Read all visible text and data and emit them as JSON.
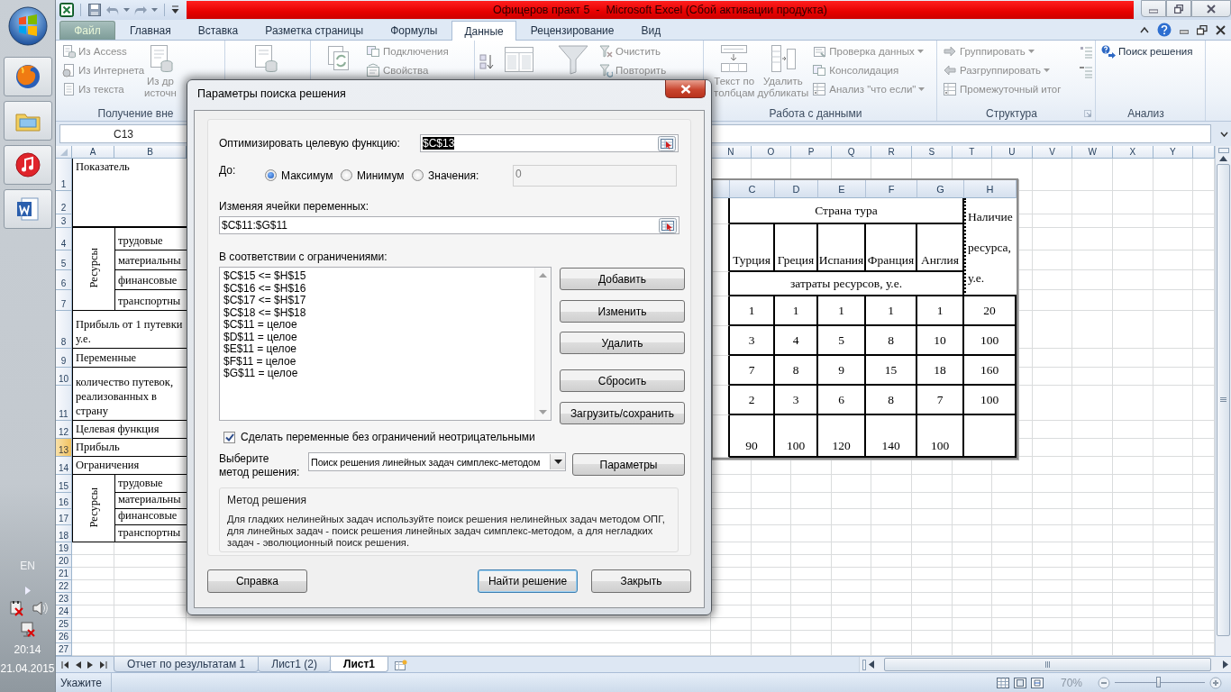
{
  "taskbar": {
    "language": "EN",
    "time": "20:14",
    "date": "21.04.2015"
  },
  "window": {
    "title": "Офицеров практ 5  -  Microsoft Excel (Сбой активации продукта)"
  },
  "ribbon_tabs": [
    {
      "label": "Файл",
      "kind": "file",
      "selected": false
    },
    {
      "label": "Главная",
      "kind": "tab",
      "selected": false
    },
    {
      "label": "Вставка",
      "kind": "tab",
      "selected": false
    },
    {
      "label": "Разметка страницы",
      "kind": "tab",
      "selected": false
    },
    {
      "label": "Формулы",
      "kind": "tab",
      "selected": false
    },
    {
      "label": "Данные",
      "kind": "tab",
      "selected": true
    },
    {
      "label": "Рецензирование",
      "kind": "tab",
      "selected": false
    },
    {
      "label": "Вид",
      "kind": "tab",
      "selected": false
    }
  ],
  "ribbon": {
    "external": {
      "label": "Получение вне",
      "items": [
        {
          "label": "Из Access",
          "disabled": true
        },
        {
          "label": "Из Интернета",
          "disabled": true
        },
        {
          "label": "Из текста",
          "disabled": true
        }
      ],
      "big_button": "Из др\nисточн"
    },
    "connections": {
      "items": [
        {
          "label": "Подключения",
          "disabled": true
        },
        {
          "label": "Свойства",
          "disabled": true
        }
      ]
    },
    "sort_filter": {
      "items": [
        {
          "label": "Очистить",
          "disabled": true
        },
        {
          "label": "Повторить",
          "disabled": true
        }
      ]
    },
    "data_tools": {
      "label": "Работа с данными",
      "big_buttons": [
        {
          "label": "Текст по\nтолбцам",
          "disabled": true
        },
        {
          "label": "Удалить\nдубликаты",
          "disabled": true
        }
      ],
      "items": [
        {
          "label": "Проверка данных",
          "disabled": true,
          "dropdown": true
        },
        {
          "label": "Консолидация",
          "disabled": true,
          "dropdown": false
        },
        {
          "label": "Анализ \"что если\"",
          "disabled": true,
          "dropdown": true
        }
      ]
    },
    "outline": {
      "label": "Структура",
      "items": [
        {
          "label": "Группировать",
          "disabled": true,
          "dropdown": true
        },
        {
          "label": "Разгруппировать",
          "disabled": true,
          "dropdown": true
        },
        {
          "label": "Промежуточный итог",
          "disabled": true,
          "dropdown": false
        }
      ]
    },
    "analysis": {
      "label": "Анализ",
      "items": [
        {
          "label": "Поиск решения",
          "disabled": false
        }
      ]
    }
  },
  "formula_bar": {
    "name_box": "C13"
  },
  "sheet": {
    "columns_left": [
      "A",
      "B"
    ],
    "columns_right": [
      "N",
      "O",
      "P",
      "Q",
      "R",
      "S",
      "T",
      "U",
      "V",
      "W",
      "X",
      "Y"
    ],
    "rows": [
      {
        "label": "1",
        "selected": false
      },
      {
        "label": "2",
        "selected": false
      },
      {
        "label": "3",
        "selected": false
      },
      {
        "label": "4",
        "selected": false
      },
      {
        "label": "5",
        "selected": false
      },
      {
        "label": "6",
        "selected": false
      },
      {
        "label": "7",
        "selected": false
      },
      {
        "label": "8",
        "selected": false
      },
      {
        "label": "9",
        "selected": false
      },
      {
        "label": "10",
        "selected": false
      },
      {
        "label": "11",
        "selected": false
      },
      {
        "label": "12",
        "selected": false
      },
      {
        "label": "13",
        "selected": true
      },
      {
        "label": "14",
        "selected": false
      },
      {
        "label": "15",
        "selected": false
      },
      {
        "label": "16",
        "selected": false
      },
      {
        "label": "17",
        "selected": false
      },
      {
        "label": "18",
        "selected": false
      },
      {
        "label": "19",
        "selected": false
      },
      {
        "label": "20",
        "selected": false
      },
      {
        "label": "21",
        "selected": false
      },
      {
        "label": "22",
        "selected": false
      },
      {
        "label": "23",
        "selected": false
      },
      {
        "label": "24",
        "selected": false
      },
      {
        "label": "25",
        "selected": false
      },
      {
        "label": "26",
        "selected": false
      },
      {
        "label": "27",
        "selected": false
      }
    ],
    "cells": {
      "title": "Показатель",
      "resources": {
        "label": "Ресурсы",
        "items": [
          "трудовые",
          "материальны",
          "финансовые",
          "транспортны"
        ]
      },
      "profit_per_trip": "Прибыль от 1 путевки у.е.",
      "variables": "Переменные",
      "trip_count": "количество путевок, реализованных в страну",
      "objective": "Целевая функция",
      "profit": "Прибыль",
      "constraints": "Ограничения",
      "constraint_resources": {
        "label": "Ресурсы",
        "items": [
          "трудовые",
          "материальны",
          "финансовые",
          "транспортны"
        ]
      }
    }
  },
  "embedded_table": {
    "columns": [
      "C",
      "D",
      "E",
      "F",
      "G",
      "H"
    ],
    "group_header": "Страна тура",
    "countries": [
      "Турция",
      "Греция",
      "Испания",
      "Франция",
      "Англия"
    ],
    "availability_header": "Наличие ресурса, у.е.",
    "subheader": "затраты ресурсов, у.е.",
    "rows": [
      [
        "1",
        "1",
        "1",
        "1",
        "1",
        "20"
      ],
      [
        "3",
        "4",
        "5",
        "8",
        "10",
        "100"
      ],
      [
        "7",
        "8",
        "9",
        "15",
        "18",
        "160"
      ],
      [
        "2",
        "3",
        "6",
        "8",
        "7",
        "100"
      ]
    ],
    "profit_row": [
      "90",
      "100",
      "120",
      "140",
      "100"
    ]
  },
  "sheet_tabs": [
    {
      "label": "Отчет по результатам 1",
      "selected": false
    },
    {
      "label": "Лист1 (2)",
      "selected": false
    },
    {
      "label": "Лист1",
      "selected": true
    }
  ],
  "status_bar": {
    "mode": "Укажите",
    "zoom": "70%",
    "zoom_slider": {
      "level": 0.48
    }
  },
  "dialog": {
    "title": "Параметры поиска решения",
    "objective": {
      "label": "Оптимизировать целевую функцию:",
      "value": "$C$13",
      "selected": true
    },
    "to": {
      "label": "До:",
      "options": [
        {
          "label": "Максимум",
          "selected": true
        },
        {
          "label": "Минимум",
          "selected": false
        },
        {
          "label": "Значения:",
          "selected": false
        }
      ],
      "value_field": {
        "value": "0",
        "disabled": true
      }
    },
    "variables": {
      "label": "Изменяя ячейки переменных:",
      "value": "$C$11:$G$11"
    },
    "constraints": {
      "label": "В соответствии с ограничениями:",
      "items": [
        "$C$15 <= $H$15",
        "$C$16 <= $H$16",
        "$C$17 <= $H$17",
        "$C$18 <= $H$18",
        "$C$11 = целое",
        "$D$11 = целое",
        "$E$11 = целое",
        "$F$11 = целое",
        "$G$11 = целое"
      ]
    },
    "side_buttons": [
      "Добавить",
      "Изменить",
      "Удалить",
      "Сбросить",
      "Загрузить/сохранить"
    ],
    "nonnegative": {
      "label": "Сделать переменные без ограничений неотрицательными",
      "checked": true
    },
    "method": {
      "label": "Выберите\nметод решения:",
      "value": "Поиск решения линейных задач симплекс-методом"
    },
    "options_button": "Параметры",
    "method_info": {
      "title": "Метод решения",
      "text": "Для гладких нелинейных задач используйте поиск решения нелинейных задач методом ОПГ, для линейных задач - поиск решения линейных задач симплекс-методом, а для негладких задач - эволюционный поиск решения."
    },
    "footer_buttons": [
      {
        "label": "Справка",
        "default": false
      },
      {
        "label": "Найти решение",
        "default": true
      },
      {
        "label": "Закрыть",
        "default": false
      }
    ]
  }
}
